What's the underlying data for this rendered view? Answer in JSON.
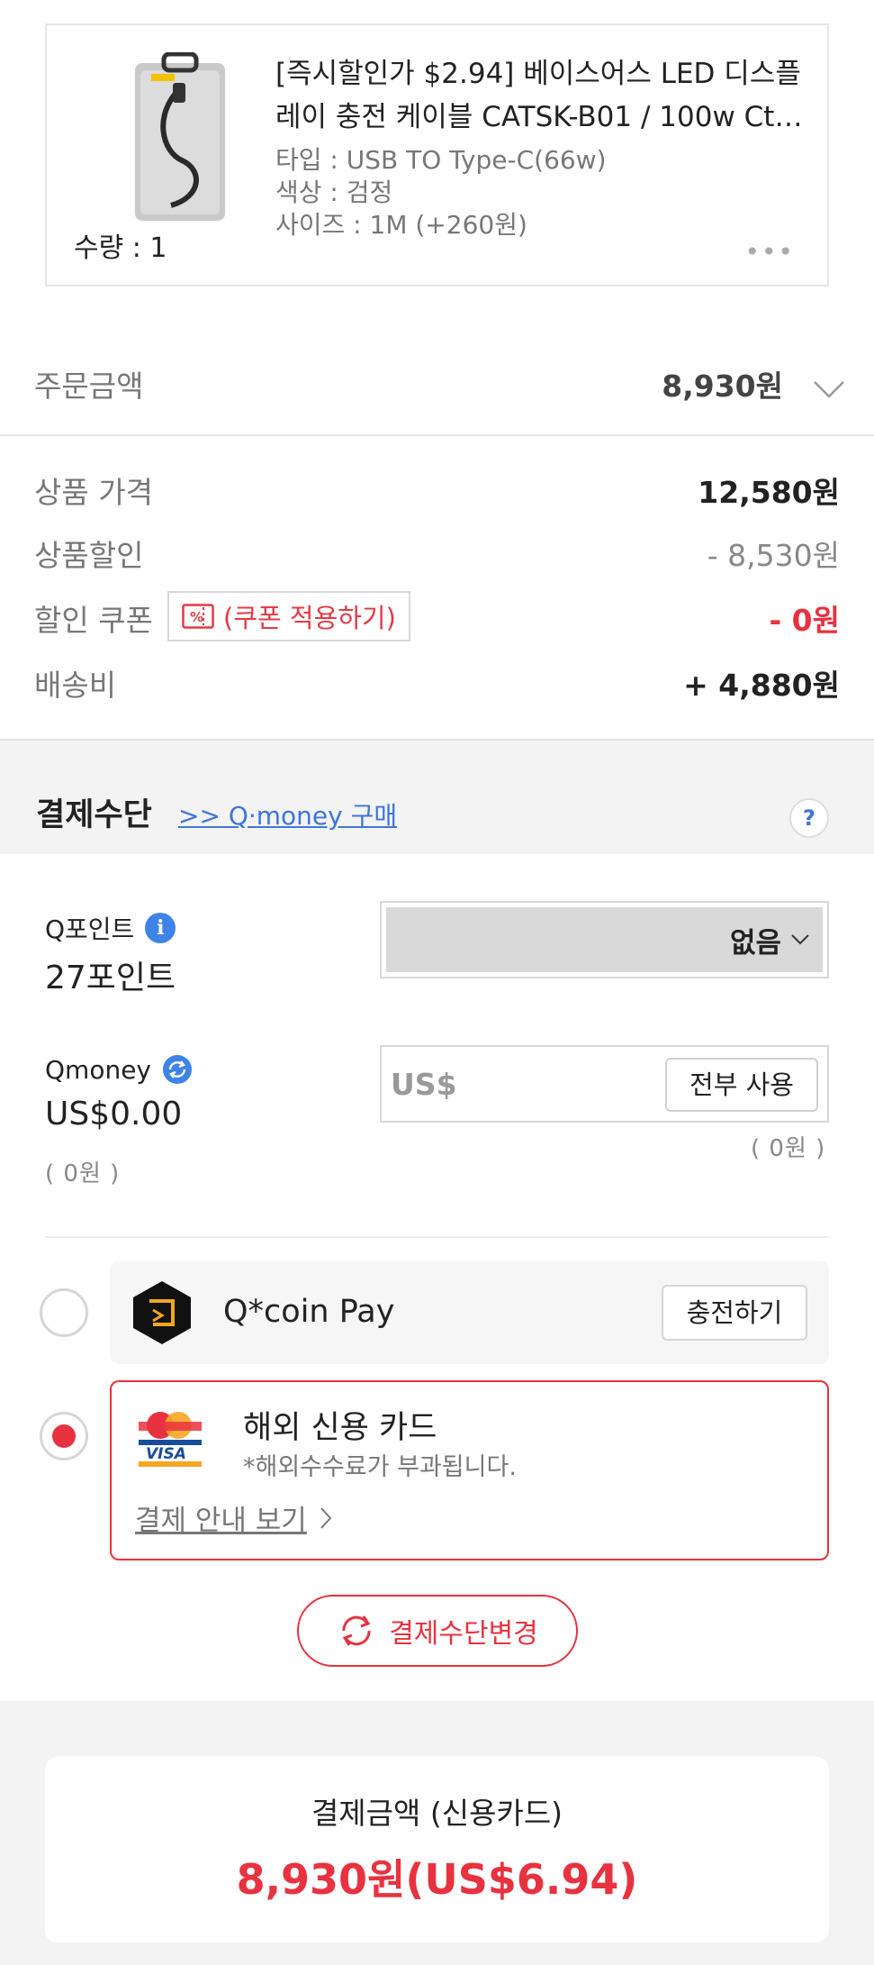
{
  "product": {
    "title_line1": "[즉시할인가 $2.94] 베이스어스 LED 디스플",
    "title_line2": "레이 충전 케이블 CATSK-B01 / 100w Cto...",
    "option_type": "타입 : USB TO Type-C(66w)",
    "option_color": "색상 : 검정",
    "option_size": "사이즈 : 1M (+260원)",
    "quantity": "수량 : 1",
    "more": "•••"
  },
  "order": {
    "label": "주문금액",
    "value": "8,930원"
  },
  "breakdown": {
    "price_label": "상품 가격",
    "price_value": "12,580원",
    "discount_label": "상품할인",
    "discount_value": "- 8,530원",
    "coupon_label": "할인 쿠폰",
    "coupon_button": "(쿠폰 적용하기)",
    "coupon_value": "- 0원",
    "shipping_label": "배송비",
    "shipping_value": "+ 4,880원"
  },
  "payment": {
    "title": "결제수단",
    "qmoney_link": ">> Q·money 구매",
    "help": "?",
    "qpoint_label": "Q포인트",
    "qpoint_value": "27포인트",
    "qpoint_select": "없음",
    "qmoney_label": "Qmoney",
    "qmoney_value": "US$0.00",
    "qmoney_won": "( 0원 )",
    "qmoney_prefix": "US$",
    "qmoney_use_all": "전부 사용",
    "qmoney_input_won": "( 0원 )",
    "qcoin_name": "Q*coin Pay",
    "qcoin_charge": "충전하기",
    "card_name": "해외 신용 카드",
    "card_note": "*해외수수료가 부과됩니다.",
    "card_guide": "결제 안내 보기",
    "change_method": "결제수단변경"
  },
  "total": {
    "label": "결제금액 (신용카드)",
    "value": "8,930원(US$6.94)"
  },
  "colors": {
    "accent_red": "#e8323f",
    "link_blue": "#3e75d9"
  }
}
